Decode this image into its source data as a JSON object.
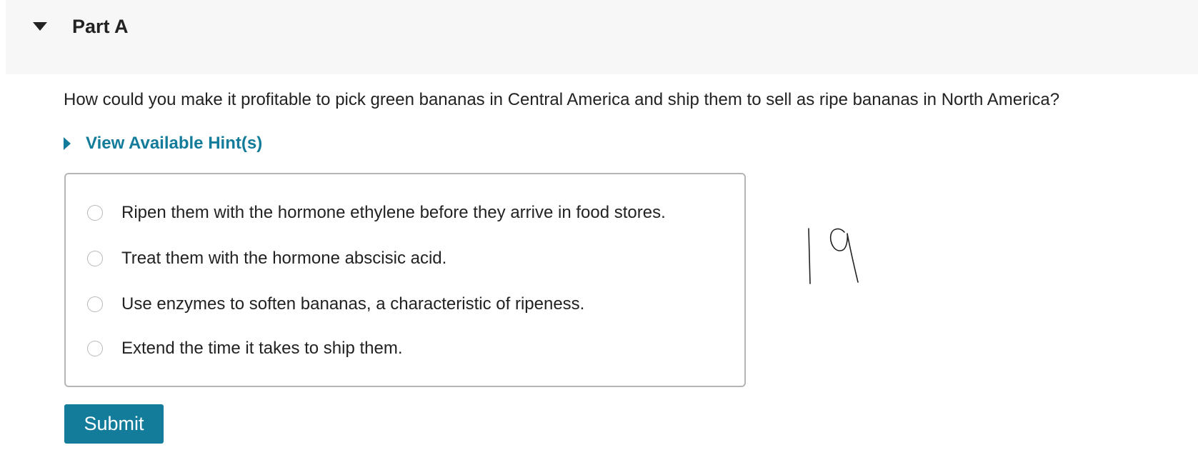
{
  "part": {
    "title": "Part A",
    "toggle_icon": "caret-down-icon"
  },
  "question": {
    "text": "How could you make it profitable to pick green bananas in Central America and ship them to sell as ripe bananas in North America?"
  },
  "hints": {
    "label": "View Available Hint(s)",
    "icon": "caret-right-icon",
    "accent": "#137c9a"
  },
  "options": [
    {
      "label": "Ripen them with the hormone ethylene before they arrive in food stores.",
      "selected": false
    },
    {
      "label": "Treat them with the hormone abscisic acid.",
      "selected": false
    },
    {
      "label": "Use enzymes to soften bananas, a characteristic of ripeness.",
      "selected": false
    },
    {
      "label": "Extend the time it takes to ship them.",
      "selected": false
    }
  ],
  "submit": {
    "label": "Submit",
    "color": "#137c9a"
  },
  "annotation": {
    "handwritten_text": "19"
  }
}
